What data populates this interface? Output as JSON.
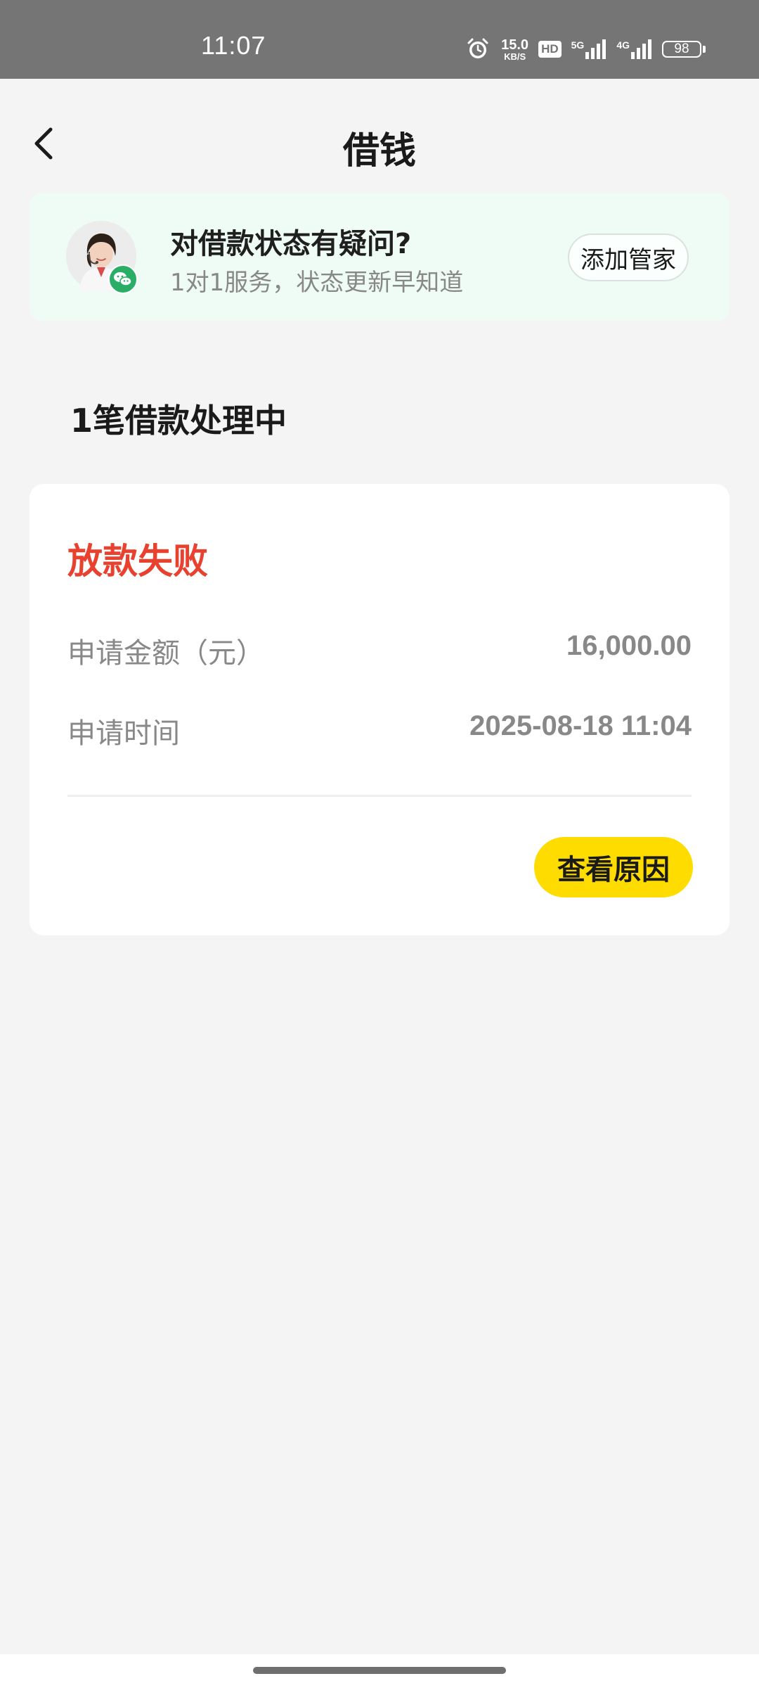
{
  "status_bar": {
    "time": "11:07",
    "net_speed_value": "15.0",
    "net_speed_unit": "KB/S",
    "hd_label": "HD",
    "network_1": "5G",
    "network_2": "4G",
    "battery": "98",
    "icons": [
      "alarm-icon",
      "hd-icon",
      "signal-5g-icon",
      "signal-4g-icon",
      "battery-icon"
    ]
  },
  "header": {
    "title": "借钱",
    "back_icon": "chevron-left-icon"
  },
  "service_banner": {
    "title": "对借款状态有疑问?",
    "subtitle": "1对1服务，状态更新早知道",
    "button_label": "添加管家",
    "badge_icon": "wechat-icon"
  },
  "section": {
    "heading": "1笔借款处理中"
  },
  "loan": {
    "status": "放款失败",
    "amount_label": "申请金额（元）",
    "amount_value": "16,000.00",
    "time_label": "申请时间",
    "time_value": "2025-08-18 11:04",
    "reason_button": "查看原因"
  },
  "colors": {
    "status_bar_bg": "#757575",
    "page_bg": "#f4f4f4",
    "banner_bg": "#effcf6",
    "fail_red": "#e9412f",
    "accent_yellow": "#ffdc00",
    "wechat_green": "#2aae67"
  }
}
